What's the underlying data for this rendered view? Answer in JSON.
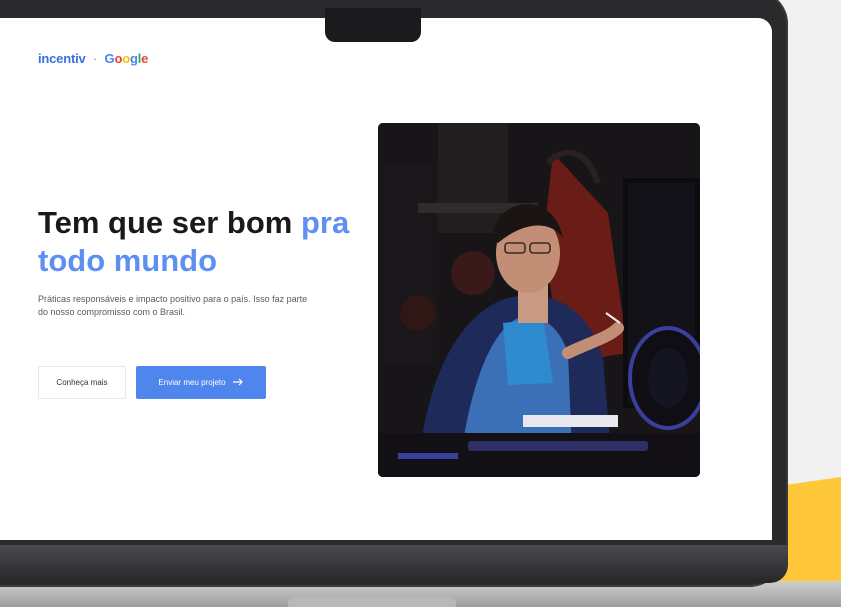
{
  "brand": {
    "name": "incentiv",
    "separator": "·",
    "partner_letters": [
      {
        "char": "G",
        "color": "#4285F4"
      },
      {
        "char": "o",
        "color": "#EA4335"
      },
      {
        "char": "o",
        "color": "#FBBC05"
      },
      {
        "char": "g",
        "color": "#4285F4"
      },
      {
        "char": "l",
        "color": "#34A853"
      },
      {
        "char": "e",
        "color": "#EA4335"
      }
    ]
  },
  "hero": {
    "title_main": "Tem que ser bom ",
    "title_accent": "pra todo mundo",
    "description": "Práticas responsáveis e impacto positivo para o país. Isso faz parte do nosso compromisso com o Brasil.",
    "secondary_button_label": "Conheça mais",
    "primary_button_label": "Enviar meu projeto",
    "primary_button_icon": "arrow-right-icon"
  },
  "colors": {
    "accent": "#5e8ff2",
    "primary_button": "#4f86ed",
    "corner_shape": "#ffc83a"
  }
}
